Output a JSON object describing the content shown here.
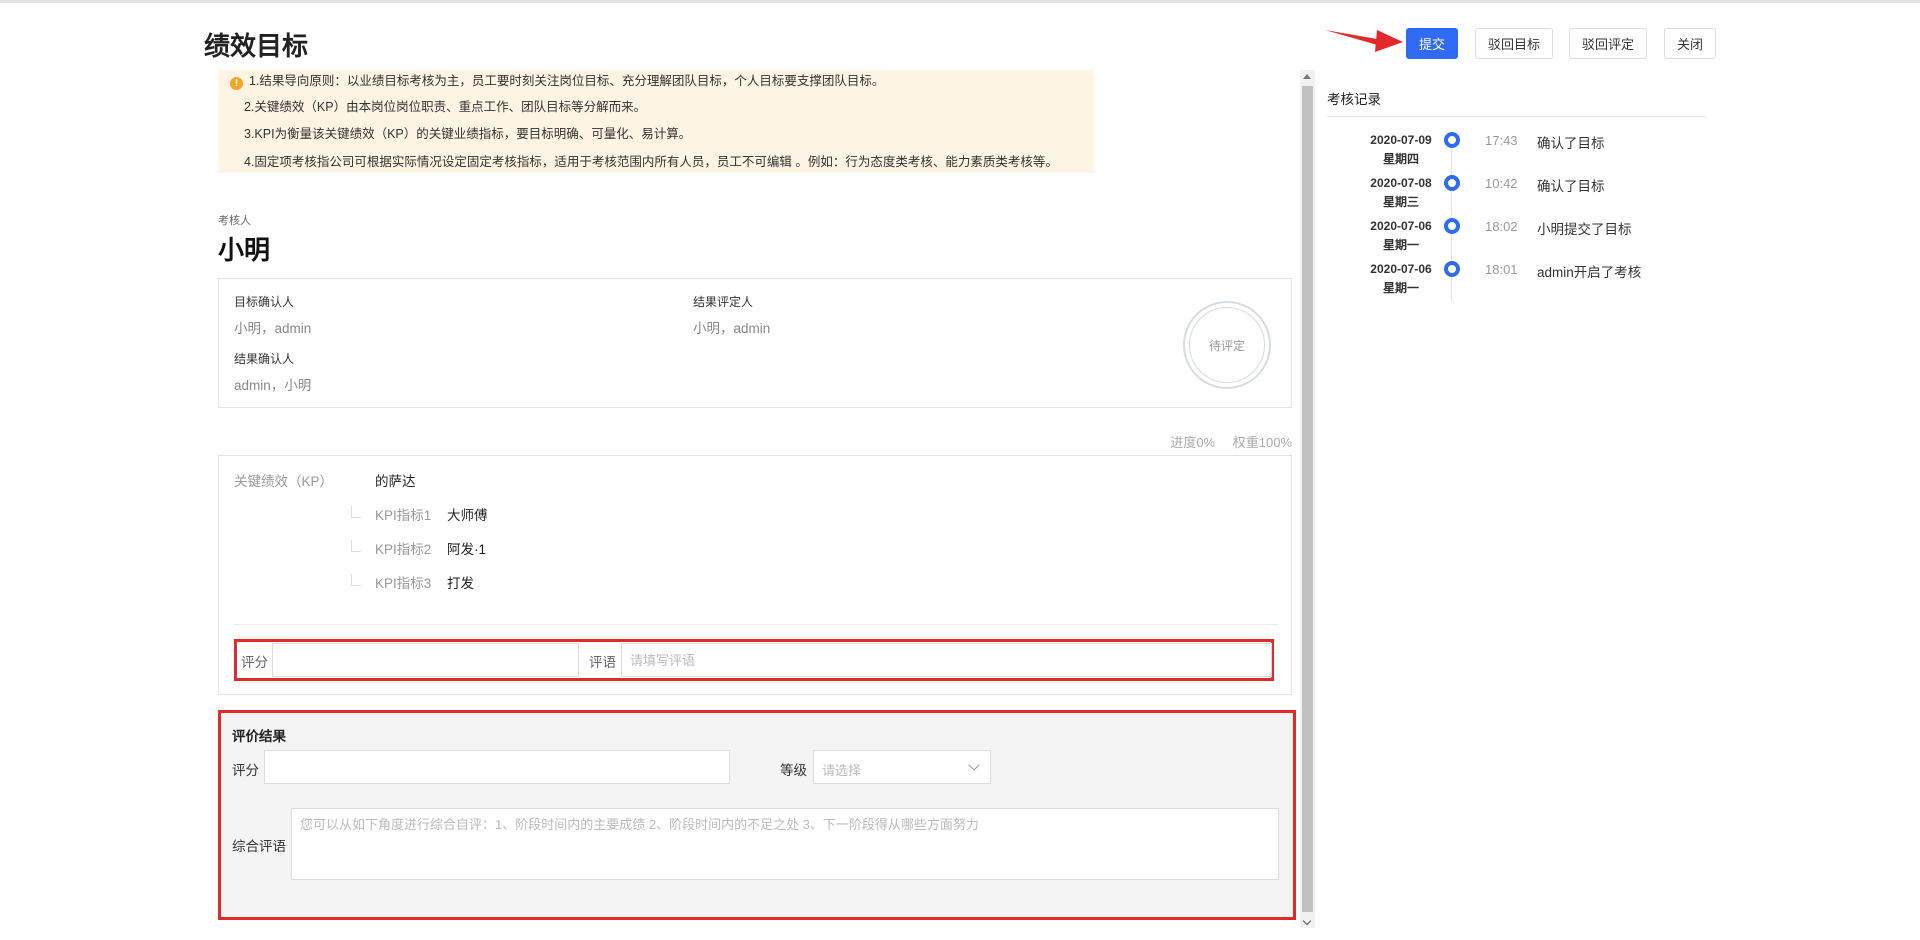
{
  "page": {
    "title": "绩效目标"
  },
  "notice": {
    "lines": [
      "1.结果导向原则：以业绩目标考核为主，员工要时刻关注岗位目标、充分理解团队目标，个人目标要支撑团队目标。",
      "2.关键绩效（KP）由本岗位岗位职责、重点工作、团队目标等分解而来。",
      "3.KPI为衡量该关键绩效（KP）的关键业绩指标，要目标明确、可量化、易计算。",
      "4.固定项考核指公司可根据实际情况设定固定考核指标，适用于考核范围内所有人员，员工不可编辑 。例如：行为态度类考核、能力素质类考核等。"
    ]
  },
  "reviewer": {
    "label": "考核人",
    "name": "小明"
  },
  "info": {
    "target_confirmer_label": "目标确认人",
    "target_confirmer_value": "小明，admin",
    "result_rater_label": "结果评定人",
    "result_rater_value": "小明，admin",
    "result_confirmer_label": "结果确认人",
    "result_confirmer_value": "admin，小明",
    "stamp": "待评定"
  },
  "progress": {
    "progress_text": "进度0%",
    "weight_text": "权重100%"
  },
  "kp": {
    "label": "关键绩效（KP）",
    "value": "的萨达",
    "kpis": [
      {
        "name": "KPI指标1",
        "value": "大师傅"
      },
      {
        "name": "KPI指标2",
        "value": "阿发·1"
      },
      {
        "name": "KPI指标3",
        "value": "打发"
      }
    ],
    "score_label": "评分",
    "score_value": "",
    "comment_label": "评语",
    "comment_placeholder": "请填写评语"
  },
  "result": {
    "title": "评价结果",
    "score_label": "评分",
    "score_value": "",
    "level_label": "等级",
    "level_placeholder": "请选择",
    "summary_label": "综合评语",
    "summary_placeholder": "您可以从如下角度进行综合自评：1、阶段时间内的主要成绩 2、阶段时间内的不足之处 3、下一阶段得从哪些方面努力"
  },
  "actions": {
    "submit": "提交",
    "reject_target": "驳回目标",
    "reject_rating": "驳回评定",
    "close": "关闭"
  },
  "log": {
    "title": "考核记录",
    "items": [
      {
        "date": "2020-07-09",
        "weekday": "星期四",
        "time": "17:43",
        "text": "确认了目标"
      },
      {
        "date": "2020-07-08",
        "weekday": "星期三",
        "time": "10:42",
        "text": "确认了目标"
      },
      {
        "date": "2020-07-06",
        "weekday": "星期一",
        "time": "18:02",
        "text": "小明提交了目标"
      },
      {
        "date": "2020-07-06",
        "weekday": "星期一",
        "time": "18:01",
        "text": "admin开启了考核"
      }
    ]
  },
  "colors": {
    "primary": "#2f6cf3",
    "highlight_border": "#e22a2a",
    "notice_bg": "#fdf4e3"
  }
}
